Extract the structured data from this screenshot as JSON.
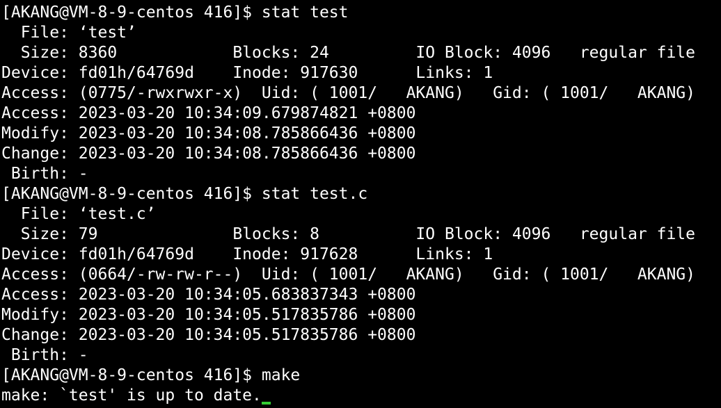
{
  "terminal": {
    "lines": [
      "[AKANG@VM-8-9-centos 416]$ stat test",
      "  File: ‘test’",
      "  Size: 8360            Blocks: 24         IO Block: 4096   regular file",
      "Device: fd01h/64769d    Inode: 917630      Links: 1",
      "Access: (0775/-rwxrwxr-x)  Uid: ( 1001/   AKANG)   Gid: ( 1001/   AKANG)",
      "Access: 2023-03-20 10:34:09.679874821 +0800",
      "Modify: 2023-03-20 10:34:08.785866436 +0800",
      "Change: 2023-03-20 10:34:08.785866436 +0800",
      " Birth: -",
      "[AKANG@VM-8-9-centos 416]$ stat test.c",
      "  File: ‘test.c’",
      "  Size: 79              Blocks: 8          IO Block: 4096   regular file",
      "Device: fd01h/64769d    Inode: 917628      Links: 1",
      "Access: (0664/-rw-rw-r--)  Uid: ( 1001/   AKANG)   Gid: ( 1001/   AKANG)",
      "Access: 2023-03-20 10:34:05.683837343 +0800",
      "Modify: 2023-03-20 10:34:05.517835786 +0800",
      "Change: 2023-03-20 10:34:05.517835786 +0800",
      " Birth: -",
      "[AKANG@VM-8-9-centos 416]$ make",
      "make: `test' is up to date."
    ],
    "colors": {
      "background": "#000000",
      "foreground": "#ffffff",
      "cursor": "#33cc33"
    }
  }
}
